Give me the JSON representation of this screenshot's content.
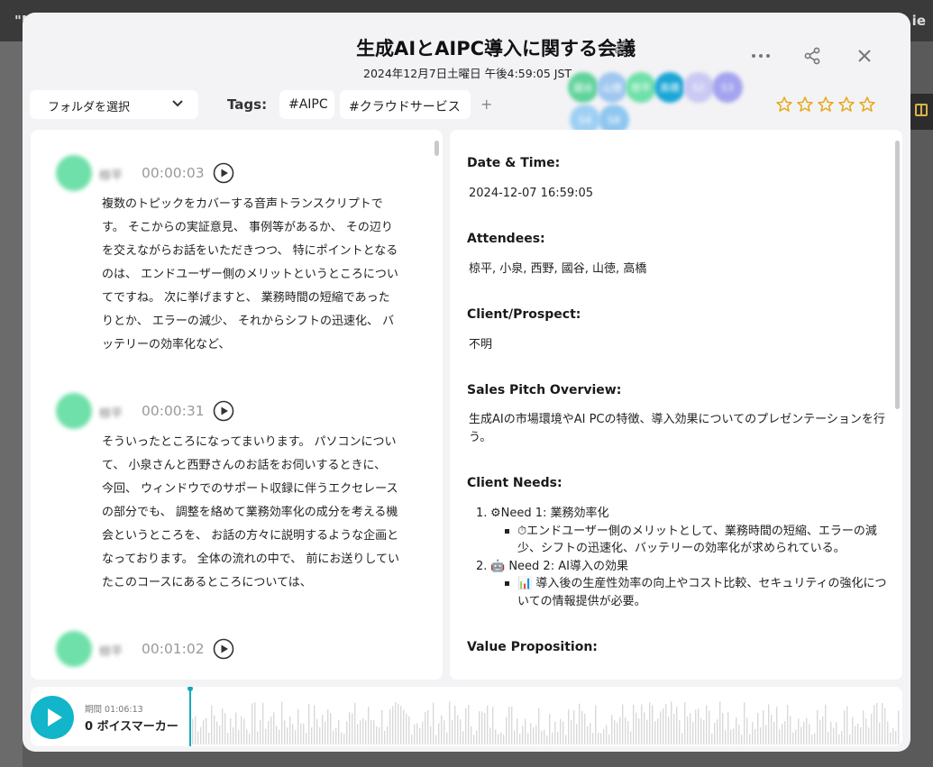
{
  "background": {
    "left_text": "\"N",
    "right_text": "ie"
  },
  "header": {
    "title": "生成AIとAIPC導入に関する会議",
    "datetime": "2024年12月7日土曜日 午後4:59:05 JST",
    "more_icon": "more-horizontal-icon",
    "share_icon": "share-icon",
    "close_icon": "close-icon"
  },
  "toolbar": {
    "folder_placeholder": "フォルダを選択",
    "tags_label": "Tags:",
    "tags": [
      "#AIPC",
      "#クラウドサービス"
    ],
    "add_tag": "+",
    "rating": 0,
    "rating_max": 5
  },
  "attendee_avatars": [
    {
      "label": "國谷",
      "color": "#5fd39a"
    },
    {
      "label": "山徳",
      "color": "#9fc7ef"
    },
    {
      "label": "椋平",
      "color": "#6fe0a9"
    },
    {
      "label": "高橋",
      "color": "#1aa6d6"
    },
    {
      "label": "S2",
      "color": "#c9c9f3"
    },
    {
      "label": "S3",
      "color": "#a3a3ef"
    },
    {
      "label": "S4",
      "color": "#9fd0f3"
    },
    {
      "label": "S8",
      "color": "#8fc7ef"
    }
  ],
  "transcript": [
    {
      "speaker": "椋平",
      "time": "00:00:03",
      "text": "複数のトピックをカバーする音声トランスクリプトで\nす。 そこからの実証意見、 事例等があるか、 その辺り\nを交えながらお話をいただきつつ、 特にポイントとなる\nのは、 エンドユーザー側のメリットというところについ\nてですね。 次に挙げますと、 業務時間の短縮であった\nりとか、 エラーの減少、 それからシフトの迅速化、 バ\nッテリーの効率化など、"
    },
    {
      "speaker": "椋平",
      "time": "00:00:31",
      "text": "そういったところになってまいります。 パソコンについ\nて、 小泉さんと西野さんのお話をお伺いするときに、\n今回、 ウィンドウでのサポート収録に伴うエクセレース\nの部分でも、 調整を絡めて業務効率化の成分を考える機\n会というところを、 お話の方々に説明するような企画と\nなっております。 全体の流れの中で、 前にお送りしてい\nたこのコースにあるところについては、"
    },
    {
      "speaker": "椋平",
      "time": "00:01:02",
      "text": ""
    }
  ],
  "summary": {
    "datetime_heading": "Date & Time:",
    "datetime_value": "2024-12-07 16:59:05",
    "attendees_heading": "Attendees:",
    "attendees_value": "椋平, 小泉, 西野, 國谷, 山徳, 高橋",
    "client_heading": "Client/Prospect:",
    "client_value": "不明",
    "pitch_heading": "Sales Pitch Overview:",
    "pitch_value": "生成AIの市場環境やAI PCの特徴、導入効果についてのプレゼンテーションを行う。",
    "needs_heading": "Client Needs:",
    "needs": [
      {
        "num": "1.",
        "icon": "⚙",
        "label": "Need 1: 業務効率化",
        "detail_icon": "⏱",
        "detail": "エンドユーザー側のメリットとして、業務時間の短縮、エラーの減少、シフトの迅速化、バッテリーの効率化が求められている。"
      },
      {
        "num": "2.",
        "icon": "🤖",
        "label": "Need 2: AI導入の効果",
        "detail_icon": "📊",
        "detail": "導入後の生産性効率の向上やコスト比較、セキュリティの強化についての情報提供が必要。"
      }
    ],
    "value_heading": "Value Proposition:"
  },
  "player": {
    "duration": "期間 01:06:13",
    "voice_markers": "0 ボイスマーカー",
    "progress": 0
  }
}
